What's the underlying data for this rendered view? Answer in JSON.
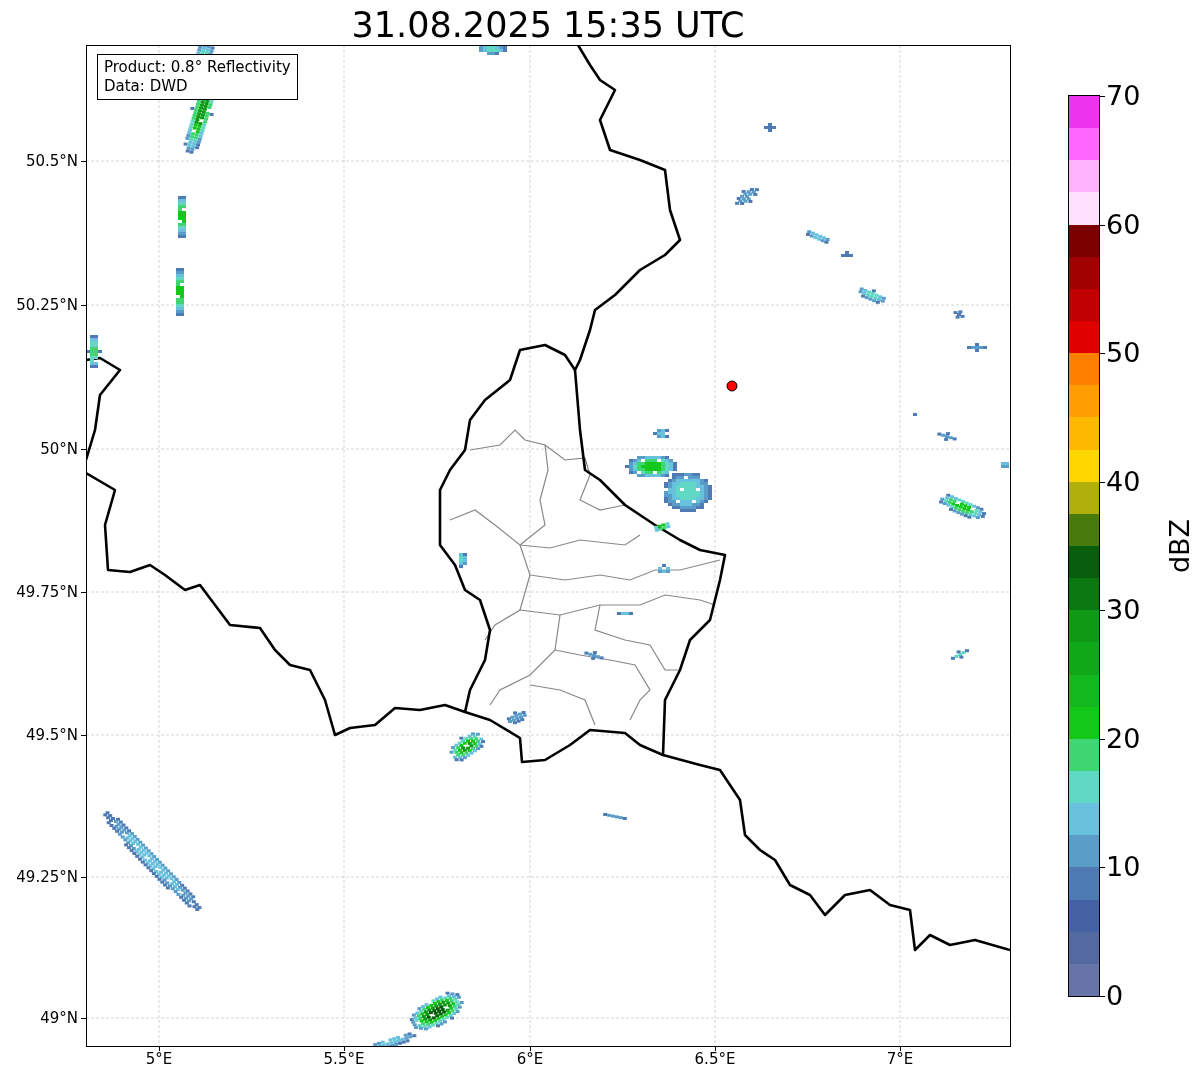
{
  "title": "31.08.2025 15:35 UTC",
  "info_box": {
    "lines": [
      "Product: 0.8° Reflectivity",
      "Data: DWD"
    ]
  },
  "map": {
    "y_ticks": [
      "50.5°N",
      "50.25°N",
      "50°N",
      "49.75°N",
      "49.5°N",
      "49.25°N",
      "49°N"
    ],
    "x_ticks": [
      "5°E",
      "5.5°E",
      "6°E",
      "6.5°E",
      "7°E"
    ]
  },
  "colorbar": {
    "label": "dBZ",
    "ticks": [
      "70",
      "60",
      "50",
      "40",
      "30",
      "20",
      "10",
      "0"
    ],
    "colors": [
      {
        "color": "#6674a8"
      },
      {
        "color": "#5469a0"
      },
      {
        "color": "#4461a3"
      },
      {
        "color": "#4e7bb3"
      },
      {
        "color": "#5a9dc8"
      },
      {
        "color": "#68c2dd"
      },
      {
        "color": "#5fd8c4"
      },
      {
        "color": "#3dd672"
      },
      {
        "color": "#14c81a"
      },
      {
        "color": "#12b81e"
      },
      {
        "color": "#10a818"
      },
      {
        "color": "#0e9a14"
      },
      {
        "color": "#0a7810"
      },
      {
        "color": "#085e0c"
      },
      {
        "color": "#487a0c"
      },
      {
        "color": "#b0b00a"
      },
      {
        "color": "#ffd700"
      },
      {
        "color": "#ffb800"
      },
      {
        "color": "#ff9c00"
      },
      {
        "color": "#ff8000"
      },
      {
        "color": "#e00000"
      },
      {
        "color": "#c00000"
      },
      {
        "color": "#a00000"
      },
      {
        "color": "#7a0000"
      },
      {
        "color": "#ffe0ff"
      },
      {
        "color": "#ffb3ff"
      },
      {
        "color": "#ff66ff"
      },
      {
        "color": "#ee33ee"
      }
    ]
  }
}
